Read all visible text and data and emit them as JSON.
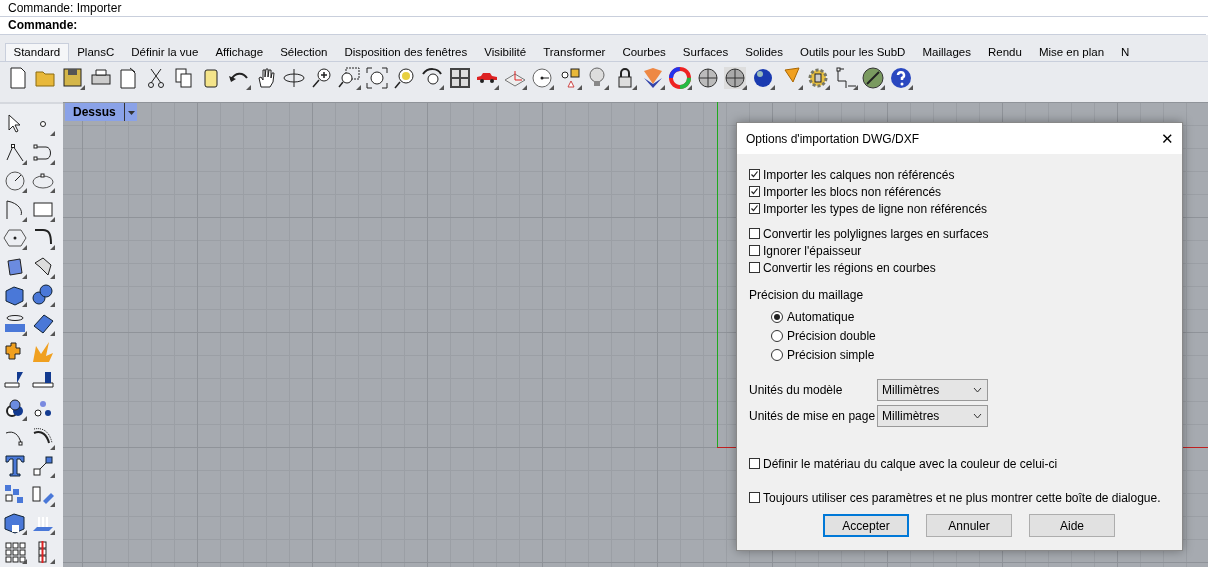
{
  "command_area": {
    "history_line": "Commande: Importer",
    "prompt": "Commande:"
  },
  "tabs": [
    {
      "label": "Standard",
      "selected": true
    },
    {
      "label": "PlansC",
      "selected": false
    },
    {
      "label": "Définir la vue",
      "selected": false
    },
    {
      "label": "Affichage",
      "selected": false
    },
    {
      "label": "Sélection",
      "selected": false
    },
    {
      "label": "Disposition des fenêtres",
      "selected": false
    },
    {
      "label": "Visibilité",
      "selected": false
    },
    {
      "label": "Transformer",
      "selected": false
    },
    {
      "label": "Courbes",
      "selected": false
    },
    {
      "label": "Surfaces",
      "selected": false
    },
    {
      "label": "Solides",
      "selected": false
    },
    {
      "label": "Outils pour les SubD",
      "selected": false
    },
    {
      "label": "Maillages",
      "selected": false
    },
    {
      "label": "Rendu",
      "selected": false
    },
    {
      "label": "Mise en plan",
      "selected": false
    },
    {
      "label": "N",
      "selected": false
    }
  ],
  "viewport": {
    "title": "Dessus"
  },
  "dialog": {
    "title": "Options d'importation DWG/DXF",
    "close": "✕",
    "import_options": [
      {
        "label": "Importer les calques non référencés",
        "checked": true
      },
      {
        "label": "Importer les blocs non référencés",
        "checked": true
      },
      {
        "label": "Importer les types de ligne non référencés",
        "checked": true
      }
    ],
    "conversion_options": [
      {
        "label": "Convertir les polylignes larges en surfaces",
        "checked": false
      },
      {
        "label": "Ignorer l'épaisseur",
        "checked": false
      },
      {
        "label": "Convertir les régions en courbes",
        "checked": false
      }
    ],
    "mesh_precision": {
      "label": "Précision du maillage",
      "options": [
        {
          "label": "Automatique",
          "selected": true
        },
        {
          "label": "Précision double",
          "selected": false
        },
        {
          "label": "Précision simple",
          "selected": false
        }
      ]
    },
    "units": [
      {
        "label": "Unités du modèle",
        "value": "Millimètres"
      },
      {
        "label": "Unités de mise en page",
        "value": "Millimètres"
      }
    ],
    "layer_material": {
      "label": "Définir le matériau du calque avec la couleur de celui-ci",
      "checked": false
    },
    "remember": {
      "label": "Toujours utiliser ces paramètres et ne plus montrer cette boîte de dialogue.",
      "checked": false
    },
    "buttons": [
      {
        "label": "Accepter",
        "default": true
      },
      {
        "label": "Annuler",
        "default": false
      },
      {
        "label": "Aide",
        "default": false
      }
    ]
  }
}
